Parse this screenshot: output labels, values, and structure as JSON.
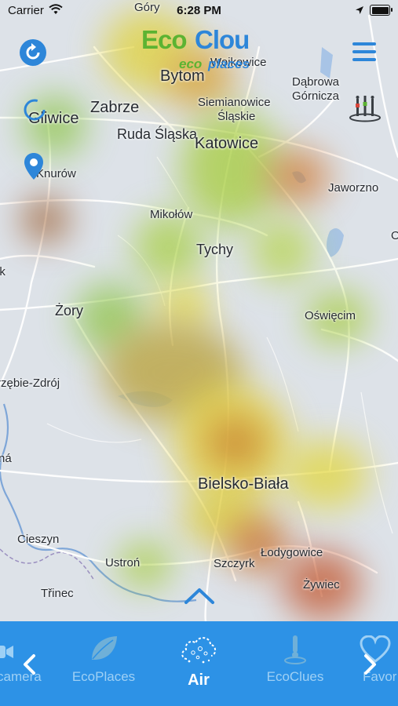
{
  "status_bar": {
    "carrier": "Carrier",
    "time": "6:28 PM"
  },
  "app": {
    "logo_word1": "Eco",
    "logo_word2": "Clou",
    "logo_sub1": "eco",
    "logo_sub2": "places"
  },
  "map": {
    "cities": [
      {
        "name": "Góry",
        "size": "s"
      },
      {
        "name": "Wojkowice",
        "size": "s"
      },
      {
        "name": "Bytom",
        "size": "l"
      },
      {
        "name": "Dąbrowa",
        "size": "s"
      },
      {
        "name": "Górnicza",
        "size": "s"
      },
      {
        "name": "Gliwice",
        "size": "l"
      },
      {
        "name": "Zabrze",
        "size": "l"
      },
      {
        "name": "Siemianowice",
        "size": "s"
      },
      {
        "name": "Śląskie",
        "size": "s"
      },
      {
        "name": "Ruda Śląska",
        "size": "m"
      },
      {
        "name": "Katowice",
        "size": "l"
      },
      {
        "name": "Knurów",
        "size": "s"
      },
      {
        "name": "Jaworzno",
        "size": "s"
      },
      {
        "name": "Mikołów",
        "size": "s"
      },
      {
        "name": "Tychy",
        "size": "m"
      },
      {
        "name": "ik",
        "size": "s"
      },
      {
        "name": "Żory",
        "size": "m"
      },
      {
        "name": "Oświęcim",
        "size": "s"
      },
      {
        "name": "rzębie-Zdrój",
        "size": "s"
      },
      {
        "name": "ná",
        "size": "s"
      },
      {
        "name": "Bielsko-Biała",
        "size": "l"
      },
      {
        "name": "Cieszyn",
        "size": "s"
      },
      {
        "name": "Ustroń",
        "size": "s"
      },
      {
        "name": "Szczyrk",
        "size": "s"
      },
      {
        "name": "Łodygowice",
        "size": "s"
      },
      {
        "name": "Třinec",
        "size": "s"
      },
      {
        "name": "Żywiec",
        "size": "s"
      },
      {
        "name": "O",
        "size": "s"
      }
    ],
    "heat_colors": {
      "low": "#8fc64a",
      "mid": "#e6da3a",
      "high": "#c85a2a"
    }
  },
  "tabs": [
    {
      "label": "camera",
      "icon": "camera-icon"
    },
    {
      "label": "EcoPlaces",
      "icon": "leaf-icon"
    },
    {
      "label": "Air",
      "icon": "air-cloud-icon",
      "active": true
    },
    {
      "label": "EcoClues",
      "icon": "thermometer-icon"
    },
    {
      "label": "Favor",
      "icon": "heart-icon"
    }
  ],
  "colors": {
    "brand_blue": "#2d86d9",
    "brand_green": "#5cb332",
    "tabbar": "#2d92e6"
  }
}
